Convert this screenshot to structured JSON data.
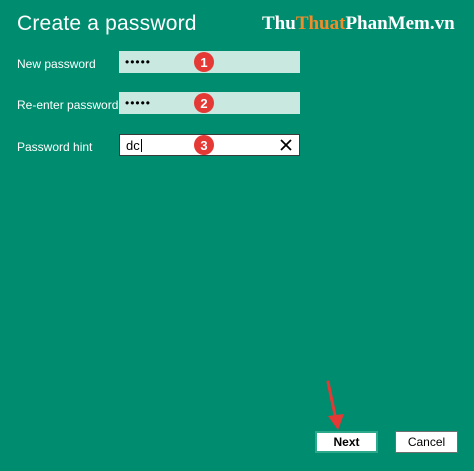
{
  "header": {
    "title": "Create a password",
    "watermark": {
      "part1": "Thu",
      "part2": "Thuat",
      "part3": "PhanMem.vn"
    }
  },
  "form": {
    "new_password": {
      "label": "New password",
      "value": "•••••",
      "badge": "1"
    },
    "reenter_password": {
      "label": "Re-enter password",
      "value": "•••••",
      "badge": "2"
    },
    "password_hint": {
      "label": "Password hint",
      "value": "dc",
      "badge": "3"
    }
  },
  "buttons": {
    "next": "Next",
    "cancel": "Cancel"
  },
  "colors": {
    "background": "#008c6e",
    "badge": "#e53935",
    "arrow": "#e53935"
  }
}
